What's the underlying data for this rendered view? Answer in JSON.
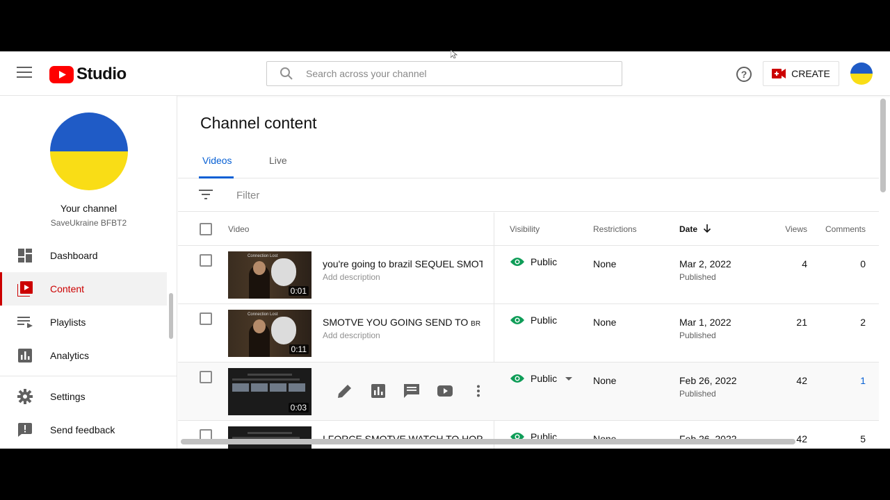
{
  "header": {
    "logo_text": "Studio",
    "search_placeholder": "Search across your channel",
    "create_label": "CREATE",
    "icons": [
      "menu-icon",
      "youtube-logo-icon",
      "search-icon",
      "help-icon",
      "camera-icon"
    ]
  },
  "sidebar": {
    "your_channel": "Your channel",
    "channel_name": "SaveUkraine BFBT2",
    "items": [
      {
        "label": "Dashboard",
        "icon": "dashboard-icon"
      },
      {
        "label": "Content",
        "icon": "content-icon",
        "active": true
      },
      {
        "label": "Playlists",
        "icon": "playlists-icon"
      },
      {
        "label": "Analytics",
        "icon": "analytics-icon"
      },
      {
        "label": "Settings",
        "icon": "gear-icon"
      },
      {
        "label": "Send feedback",
        "icon": "feedback-icon"
      }
    ]
  },
  "main": {
    "title": "Channel content",
    "tabs": [
      {
        "label": "Videos",
        "active": true
      },
      {
        "label": "Live"
      }
    ],
    "filter_placeholder": "Filter",
    "columns": {
      "video": "Video",
      "visibility": "Visibility",
      "restrictions": "Restrictions",
      "date": "Date",
      "views": "Views",
      "comments": "Comments"
    },
    "rows": [
      {
        "title": "you're going to brazil SEQUEL SMOTV...",
        "description": "Add description",
        "thumb_label": "Connection Lost",
        "duration": "0:01",
        "visibility": "Public",
        "restrictions": "None",
        "date": "Mar 2, 2022",
        "status": "Published",
        "views": "4",
        "comments": "0"
      },
      {
        "title": "SMOTVE YOU GOING SEND TO",
        "title_small": "BR",
        "description": "Add description",
        "thumb_label": "Connection Lost",
        "duration": "0:11",
        "visibility": "Public",
        "restrictions": "None",
        "date": "Mar 1, 2022",
        "status": "Published",
        "views": "21",
        "comments": "2"
      },
      {
        "title": "",
        "duration": "0:03",
        "visibility": "Public",
        "restrictions": "None",
        "date": "Feb 26, 2022",
        "status": "Published",
        "views": "42",
        "comments": "1"
      },
      {
        "title": "I FORCE SMOTVE WATCH TO HOPLAIL",
        "visibility": "Public",
        "restrictions": "None",
        "date": "Feb 26, 2022",
        "views": "42",
        "comments": "5"
      }
    ]
  },
  "colors": {
    "accent_blue": "#065fd4",
    "active_red": "#cc0000",
    "visibility_green": "#0f9d58",
    "flag_blue": "#1f5bc6",
    "flag_yellow": "#f9dd16"
  }
}
